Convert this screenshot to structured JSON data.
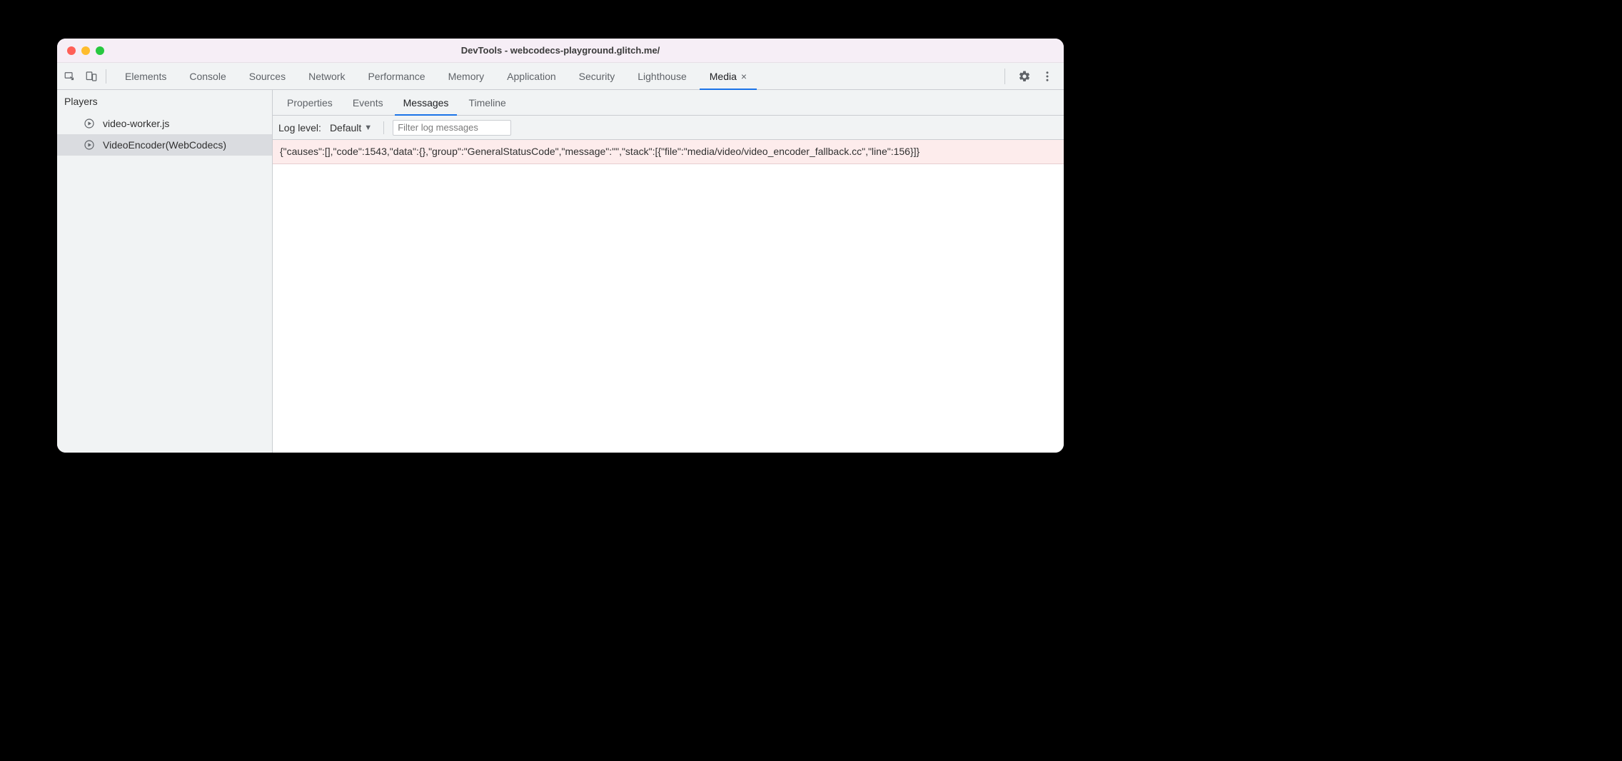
{
  "window": {
    "title": "DevTools - webcodecs-playground.glitch.me/"
  },
  "panels": {
    "items": [
      {
        "label": "Elements"
      },
      {
        "label": "Console"
      },
      {
        "label": "Sources"
      },
      {
        "label": "Network"
      },
      {
        "label": "Performance"
      },
      {
        "label": "Memory"
      },
      {
        "label": "Application"
      },
      {
        "label": "Security"
      },
      {
        "label": "Lighthouse"
      },
      {
        "label": "Media"
      }
    ],
    "active": "Media",
    "close_x": "×"
  },
  "sidebar": {
    "heading": "Players",
    "items": [
      {
        "label": "video-worker.js"
      },
      {
        "label": "VideoEncoder(WebCodecs)"
      }
    ],
    "selected": "VideoEncoder(WebCodecs)"
  },
  "sub_tabs": {
    "items": [
      {
        "label": "Properties"
      },
      {
        "label": "Events"
      },
      {
        "label": "Messages"
      },
      {
        "label": "Timeline"
      }
    ],
    "active": "Messages"
  },
  "filter_bar": {
    "label": "Log level:",
    "dropdown_value": "Default",
    "filter_placeholder": "Filter log messages"
  },
  "log": {
    "rows": [
      "{\"causes\":[],\"code\":1543,\"data\":{},\"group\":\"GeneralStatusCode\",\"message\":\"\",\"stack\":[{\"file\":\"media/video/video_encoder_fallback.cc\",\"line\":156}]}"
    ]
  }
}
